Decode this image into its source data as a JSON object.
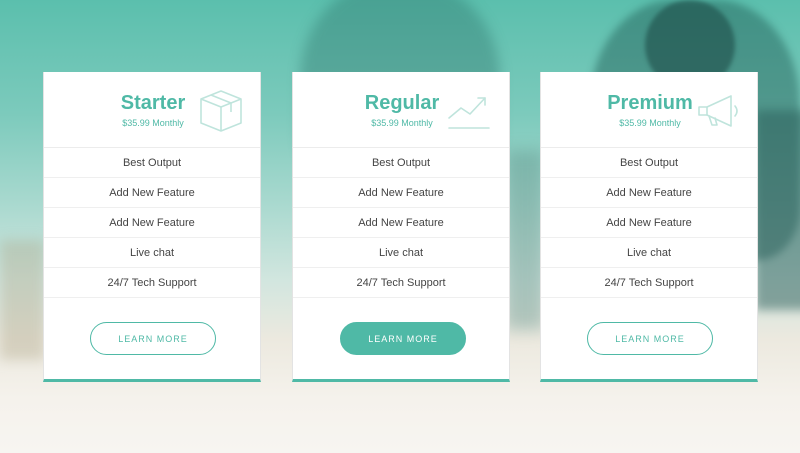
{
  "colors": {
    "accent": "#4fb9a6",
    "text": "#444444",
    "card_bg": "#ffffff"
  },
  "plans": [
    {
      "title": "Starter",
      "price": "$35.99 Monthly",
      "icon": "box-icon",
      "features": [
        "Best Output",
        "Add New Feature",
        "Add New Feature",
        "Live chat",
        "24/7 Tech Support"
      ],
      "button_label": "LEARN MORE",
      "button_style": "outline"
    },
    {
      "title": "Regular",
      "price": "$35.99 Monthly",
      "icon": "trend-chart-icon",
      "features": [
        "Best Output",
        "Add New Feature",
        "Add New Feature",
        "Live chat",
        "24/7 Tech Support"
      ],
      "button_label": "LEARN MORE",
      "button_style": "filled"
    },
    {
      "title": "Premium",
      "price": "$35.99 Monthly",
      "icon": "megaphone-icon",
      "features": [
        "Best Output",
        "Add New Feature",
        "Add New Feature",
        "Live chat",
        "24/7 Tech Support"
      ],
      "button_label": "LEARN MORE",
      "button_style": "outline"
    }
  ]
}
